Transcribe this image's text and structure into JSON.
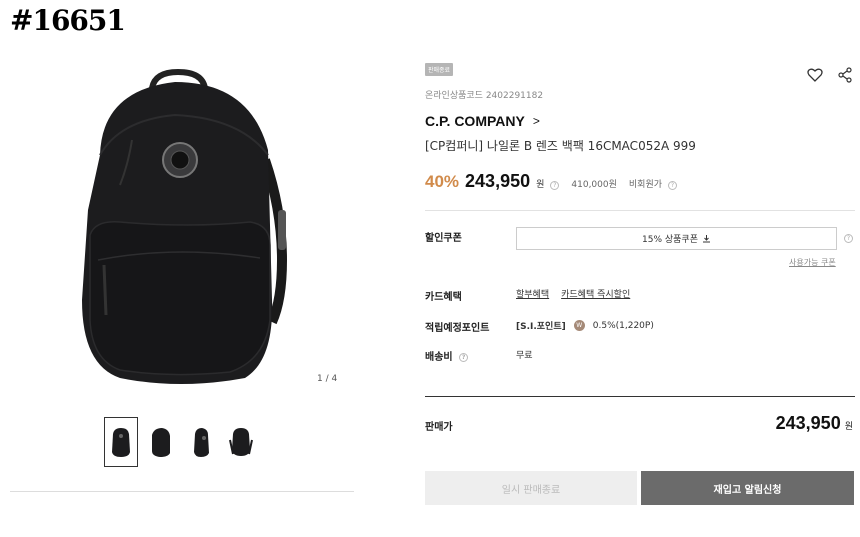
{
  "watermark": "#16651",
  "gallery": {
    "pager": "1 / 4",
    "thumbnails": [
      "thumb-front",
      "thumb-angle",
      "thumb-side",
      "thumb-back"
    ]
  },
  "product": {
    "badge": "판매종료",
    "code_label": "온라인상품코드 2402291182",
    "brand": "C.P. COMPANY",
    "brand_chevron": ">",
    "name": "[CP컴퍼니] 나일론 B 렌즈 백팩 16CMAC052A 999",
    "discount": "40%",
    "price": "243,950",
    "currency": "원",
    "original_price": "410,000원",
    "compare_label": "비회원가"
  },
  "benefits": {
    "coupon_label": "할인쿠폰",
    "coupon_button": "15% 상품쿠폰",
    "coupon_link": "사용가능 쿠폰",
    "card_label": "카드혜택",
    "card_links": [
      "할부혜택",
      "카드혜택 즉시할인"
    ],
    "points_label": "적립예정포인트",
    "points_tag": "[S.I.포인트]",
    "points_value": "0.5%(1,220P)",
    "shipping_label": "배송비",
    "shipping_value": "무료"
  },
  "sale": {
    "label": "판매가",
    "price": "243,950",
    "currency": "원"
  },
  "buttons": {
    "sold_out": "일시 판매종료",
    "notify": "재입고 알림신청"
  },
  "colors": {
    "discount": "#d18b4b",
    "notify_button": "#6b6b6b"
  }
}
